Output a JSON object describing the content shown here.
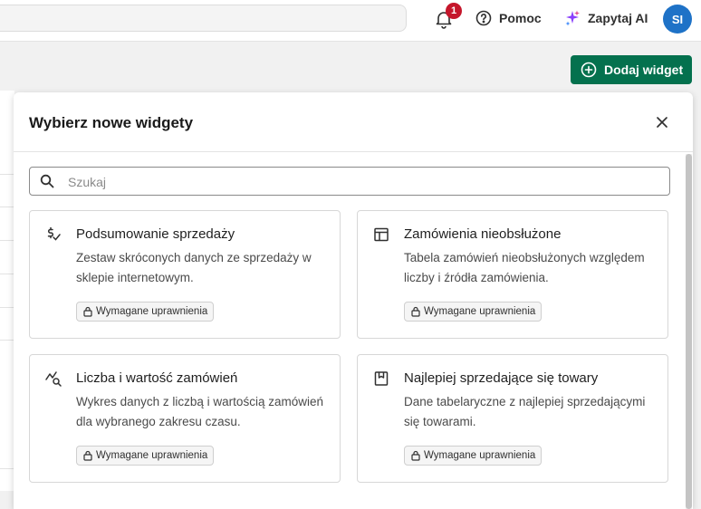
{
  "topbar": {
    "notification_count": "1",
    "help_label": "Pomoc",
    "ai_label": "Zapytaj AI",
    "avatar_initials": "SI"
  },
  "page": {
    "add_widget_label": "Dodaj widget"
  },
  "modal": {
    "title": "Wybierz nowe widgety",
    "search_placeholder": "Szukaj",
    "cards": [
      {
        "icon": "sales-summary-icon",
        "title": "Podsumowanie sprzedaży",
        "description": "Zestaw skróconych danych ze sprzedaży w sklepie internetowym.",
        "badge": "Wymagane uprawnienia"
      },
      {
        "icon": "table-icon",
        "title": "Zamówienia nieobsłużone",
        "description": "Tabela zamówień nieobsłużonych względem liczby i źródła zamówienia.",
        "badge": "Wymagane uprawnienia"
      },
      {
        "icon": "chart-search-icon",
        "title": "Liczba i wartość zamówień",
        "description": "Wykres danych z liczbą i wartością zamówień dla wybranego zakresu czasu.",
        "badge": "Wymagane uprawnienia"
      },
      {
        "icon": "bookmark-box-icon",
        "title": "Najlepiej sprzedające się towary",
        "description": "Dane tabelaryczne z najlepiej sprzedającymi się towarami.",
        "badge": "Wymagane uprawnienia"
      }
    ]
  },
  "colors": {
    "primary": "#04714e",
    "avatar": "#1e72c7",
    "badge": "#c5162b"
  }
}
